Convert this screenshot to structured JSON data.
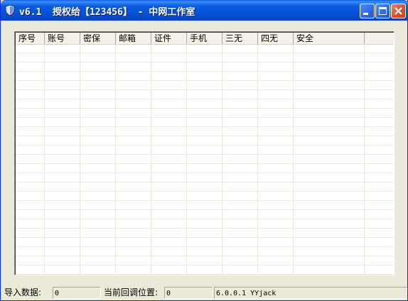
{
  "window": {
    "title": "v6.1  授权给【123456】 - 中网工作室",
    "colors": {
      "titlebar": "#0553d6",
      "close": "#d9512c",
      "face": "#ece9d8"
    }
  },
  "titlebar_buttons": {
    "minimize_icon": "minimize-icon",
    "maximize_icon": "maximize-icon",
    "close_icon": "close-icon"
  },
  "list": {
    "columns": [
      "序号",
      "账号",
      "密保",
      "邮箱",
      "证件",
      "手机",
      "三无",
      "四无",
      "安全"
    ]
  },
  "statusbar": {
    "import_label": "导入数据:",
    "import_value": "0",
    "position_label": "当前回调位置:",
    "position_value": "0",
    "version": "6.0.0.1 YYjack"
  }
}
